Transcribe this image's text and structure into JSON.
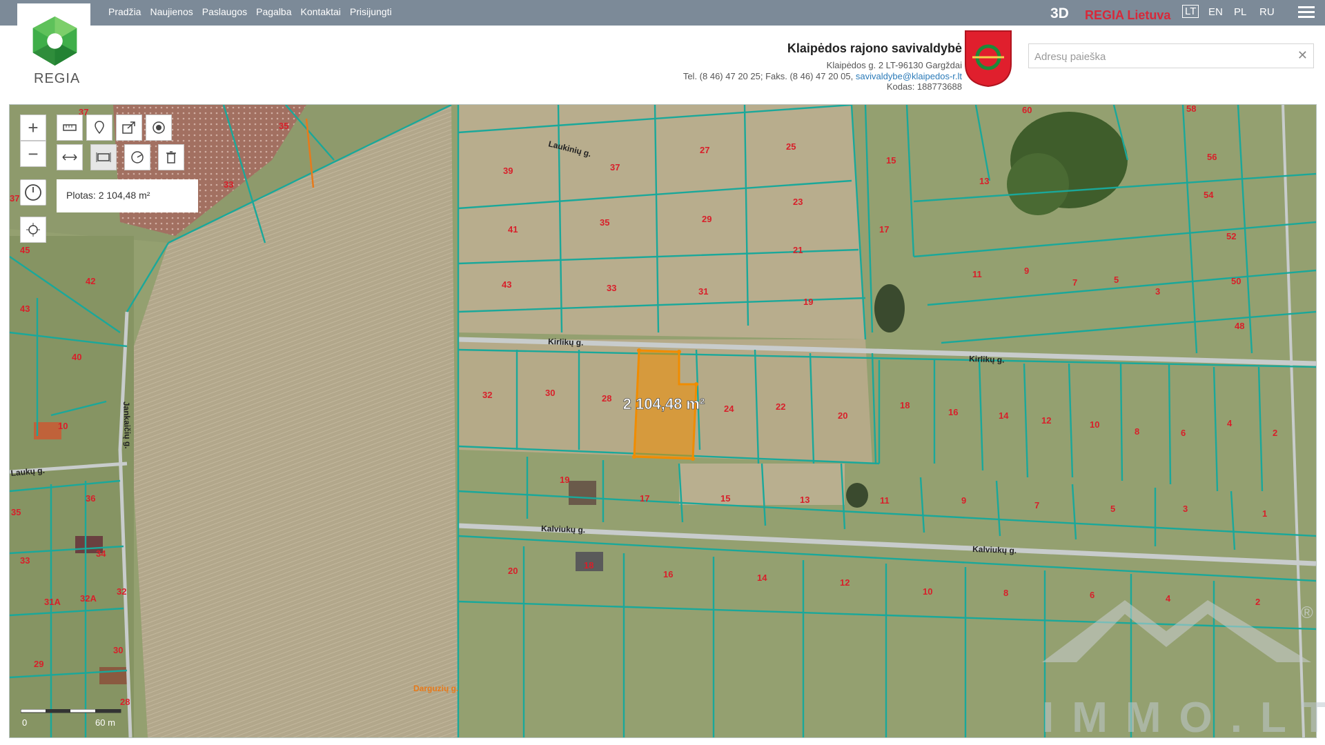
{
  "nav": {
    "items": [
      "Pradžia",
      "Naujienos",
      "Paslaugos",
      "Pagalba",
      "Kontaktai",
      "Prisijungti"
    ]
  },
  "topright": {
    "btn_3d": "3D",
    "regia_lt": "REGIA Lietuva",
    "langs": [
      "LT",
      "EN",
      "PL",
      "RU"
    ]
  },
  "brand": {
    "logo_text": "REGIA"
  },
  "municipality": {
    "name": "Klaipėdos rajono savivaldybė",
    "address": "Klaipėdos g. 2 LT-96130 Gargždai",
    "phone": "Tel. (8 46) 47 20 25; Faks. (8 46) 47 20 05,",
    "email": "savivaldybe@klaipedos-r.lt",
    "code": "Kodas: 188773688"
  },
  "search": {
    "placeholder": "Adresų paieška",
    "value": ""
  },
  "map": {
    "area_label": "Plotas: 2 104,48 m²",
    "selected_area": "2 104,48 m²",
    "streets": [
      "Laukinių g.",
      "Kirlikų g.",
      "Kirlikų g.",
      "Kalviukų g.",
      "Kalviukų g.",
      "Jankaičių g.",
      "Laukų g.",
      "Darguzių g."
    ],
    "scale": {
      "zero": "0",
      "max": "60 m"
    },
    "watermark": "IMMO.LT",
    "watermark_mark": "®",
    "parcels_left": [
      "37",
      "35",
      "33",
      "45",
      "42",
      "43",
      "40",
      "10",
      "36",
      "35",
      "34",
      "33",
      "31A",
      "32A",
      "32",
      "30",
      "29",
      "28",
      "37"
    ],
    "parcels_mid": [
      "39",
      "37",
      "27",
      "25",
      "41",
      "35",
      "29",
      "23",
      "21",
      "43",
      "33",
      "31",
      "19",
      "32",
      "30",
      "28",
      "24",
      "22",
      "20",
      "19",
      "17",
      "15",
      "13",
      "20",
      "18",
      "16",
      "14",
      "12",
      "10",
      "8",
      "6",
      "4",
      "2"
    ],
    "parcels_right": [
      "60",
      "58",
      "15",
      "13",
      "56",
      "54",
      "17",
      "52",
      "11",
      "9",
      "7",
      "5",
      "3",
      "50",
      "48",
      "18",
      "16",
      "14",
      "12",
      "10",
      "8",
      "6",
      "4",
      "2",
      "11",
      "9",
      "7",
      "5",
      "3",
      "1"
    ]
  },
  "colors": {
    "topbar": "#7c8a98",
    "parcel_line": "#1aa89a",
    "selection": "#f08c00",
    "parcel_num": "#d81f2a",
    "regia_red": "#d8283a"
  }
}
